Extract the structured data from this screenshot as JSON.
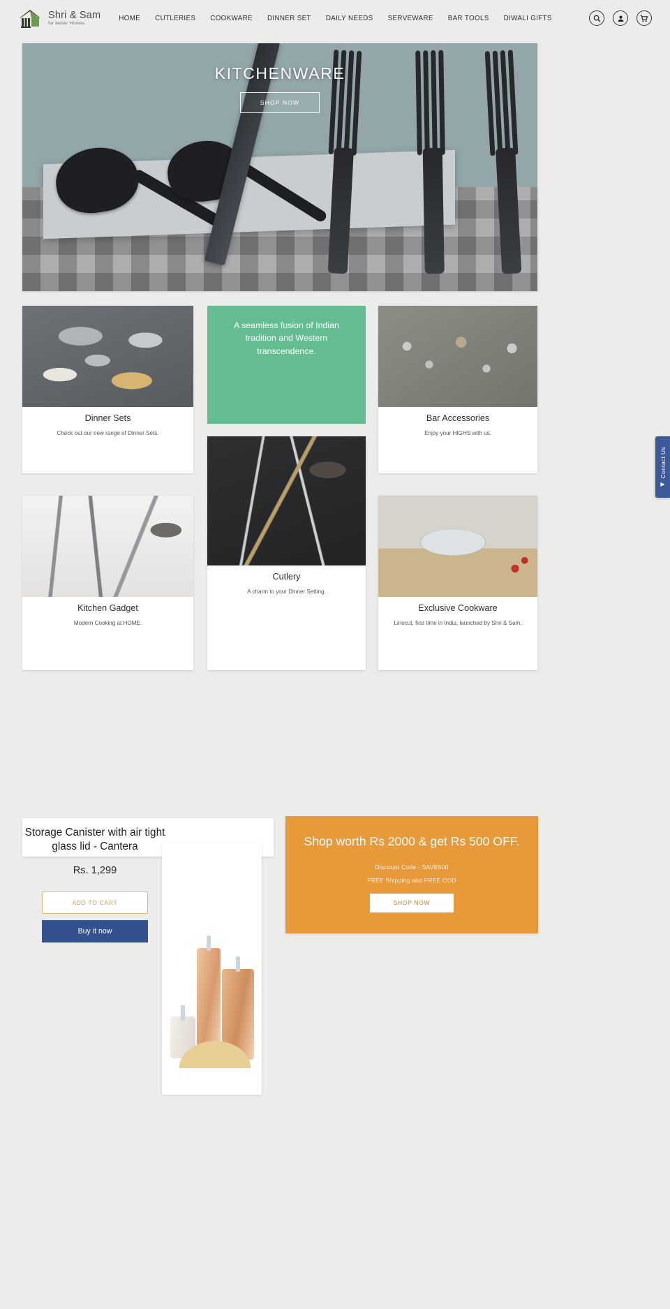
{
  "header": {
    "logo_name": "Shri & Sam",
    "logo_tagline": "for better Homes",
    "nav": [
      {
        "label": "HOME"
      },
      {
        "label": "CUTLERIES"
      },
      {
        "label": "COOKWARE"
      },
      {
        "label": "DINNER SET"
      },
      {
        "label": "DAILY NEEDS"
      },
      {
        "label": "SERVEWARE"
      },
      {
        "label": "BAR TOOLS"
      },
      {
        "label": "DIWALI GIFTS"
      }
    ],
    "icons": {
      "search": "search-icon",
      "account": "account-icon",
      "cart": "cart-icon"
    }
  },
  "hero": {
    "title": "KITCHENWARE",
    "button_label": "SHOP NOW"
  },
  "tagline_card": {
    "text": "A seamless fusion of Indian tradition and Western transcendence.",
    "color": "#63bd91"
  },
  "categories": [
    {
      "title": "Dinner Sets",
      "description": "Check out our new range of Dinner Sets."
    },
    {
      "title": "Bar Accessories",
      "description": "Enjoy your HIGHS with us."
    },
    {
      "title": "Kitchen Gadget",
      "description": "Modern Cooking at HOME."
    },
    {
      "title": "Cutlery",
      "description": "A charm to your Dinner Setting."
    },
    {
      "title": "Exclusive Cookware",
      "description": "Linocut, first time in India, launched by Shri & Sam."
    }
  ],
  "contact_tab": {
    "label": "Contact Us",
    "arrow": "▶"
  },
  "product": {
    "title": "Storage Canister with air tight glass lid - Cantera",
    "price": "Rs. 1,299",
    "add_to_cart_label": "ADD TO CART",
    "buy_now_label": "Buy it now",
    "accent_gold": "#c4a052",
    "accent_blue": "#33508f"
  },
  "promo": {
    "title": "Shop worth Rs 2000 & get Rs 500 OFF.",
    "discount_code_line": "Discount Code - SAVE500",
    "shipping_line": "FREE Shipping and FREE COD",
    "button_label": "SHOP NOW",
    "background": "#e8993a"
  }
}
